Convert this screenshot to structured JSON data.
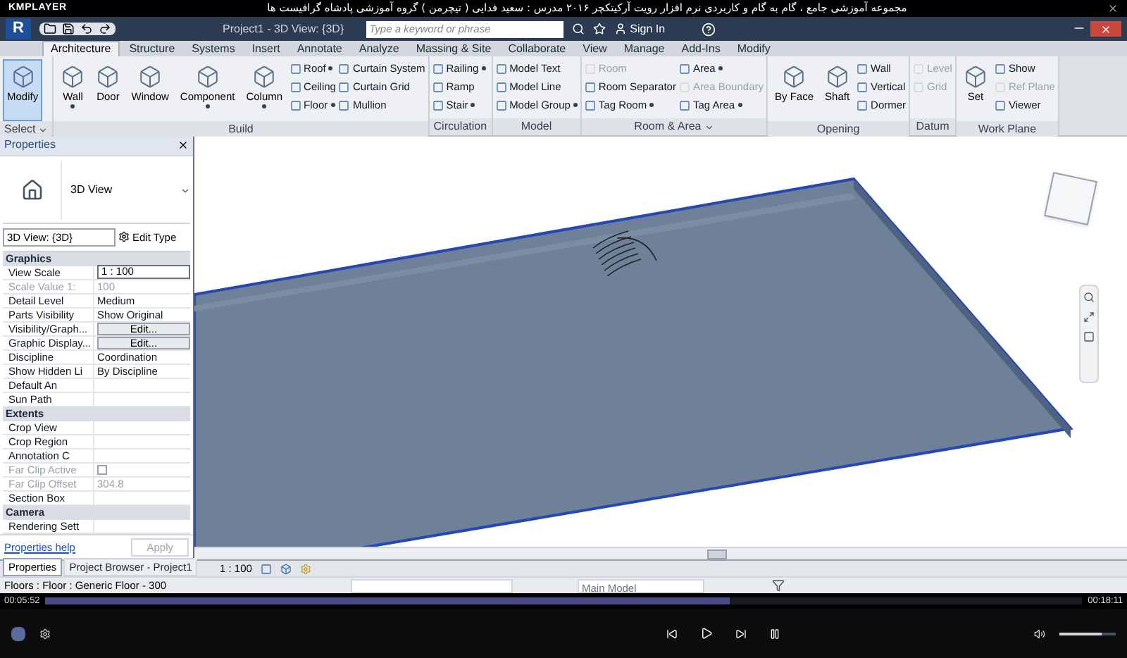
{
  "player": {
    "name": "KMPLAYER",
    "title": "مجموعه آموزشی جامع ، گام به گام و کاربردی نرم افزار رویت آرکیتکچر ۲۰۱۶   مدرس : سعید فدایی ( تیچرمن ) گروه آموزشی پادشاه گرافیست ها",
    "elapsed": "00:05:52",
    "total": "00:18:11",
    "seek": {
      "level": 0.66
    },
    "volume": {
      "level": 0.75
    }
  },
  "app": {
    "logo": "R",
    "title": "Project1 - 3D View: {3D}",
    "search": {
      "placeholder": "Type a keyword or phrase"
    },
    "sign_in": "Sign In"
  },
  "tabs": [
    {
      "label": "Architecture",
      "selected": true
    },
    {
      "label": "Structure",
      "selected": false
    },
    {
      "label": "Systems",
      "selected": false
    },
    {
      "label": "Insert",
      "selected": false
    },
    {
      "label": "Annotate",
      "selected": false
    },
    {
      "label": "Analyze",
      "selected": false
    },
    {
      "label": "Massing & Site",
      "selected": false
    },
    {
      "label": "Collaborate",
      "selected": false
    },
    {
      "label": "View",
      "selected": false
    },
    {
      "label": "Manage",
      "selected": false
    },
    {
      "label": "Add-Ins",
      "selected": false
    },
    {
      "label": "Modify",
      "selected": false
    }
  ],
  "ribbon": [
    {
      "title": "Select",
      "menu": true,
      "columns": [
        {
          "kind": "large",
          "label": "Modify",
          "selected": true,
          "dropdown": false
        }
      ]
    },
    {
      "title": "Build",
      "menu": false,
      "columns": [
        {
          "kind": "large",
          "label": "Wall",
          "selected": false,
          "dropdown": true
        },
        {
          "kind": "large",
          "label": "Door",
          "selected": false,
          "dropdown": false
        },
        {
          "kind": "large",
          "label": "Window",
          "selected": false,
          "dropdown": false
        },
        {
          "kind": "large",
          "label": "Component",
          "selected": false,
          "dropdown": true
        },
        {
          "kind": "large",
          "label": "Column",
          "selected": false,
          "dropdown": true
        },
        {
          "kind": "stack",
          "items": [
            {
              "label": "Roof",
              "disabled": false,
              "dropdown": true
            },
            {
              "label": "Ceiling",
              "disabled": false,
              "dropdown": false
            },
            {
              "label": "Floor",
              "disabled": false,
              "dropdown": true
            }
          ]
        },
        {
          "kind": "stack",
          "items": [
            {
              "label": "Curtain System",
              "disabled": false,
              "dropdown": false
            },
            {
              "label": "Curtain Grid",
              "disabled": false,
              "dropdown": false
            },
            {
              "label": "Mullion",
              "disabled": false,
              "dropdown": false
            }
          ]
        }
      ]
    },
    {
      "title": "Circulation",
      "menu": false,
      "columns": [
        {
          "kind": "stack",
          "items": [
            {
              "label": "Railing",
              "disabled": false,
              "dropdown": true
            },
            {
              "label": "Ramp",
              "disabled": false,
              "dropdown": false
            },
            {
              "label": "Stair",
              "disabled": false,
              "dropdown": true
            }
          ]
        }
      ]
    },
    {
      "title": "Model",
      "menu": false,
      "columns": [
        {
          "kind": "stack",
          "items": [
            {
              "label": "Model Text",
              "disabled": false,
              "dropdown": false
            },
            {
              "label": "Model Line",
              "disabled": false,
              "dropdown": false
            },
            {
              "label": "Model Group",
              "disabled": false,
              "dropdown": true
            }
          ]
        }
      ]
    },
    {
      "title": "Room & Area",
      "menu": true,
      "columns": [
        {
          "kind": "stack",
          "items": [
            {
              "label": "Room",
              "disabled": true,
              "dropdown": false
            },
            {
              "label": "Room Separator",
              "disabled": false,
              "dropdown": false
            },
            {
              "label": "Tag Room",
              "disabled": false,
              "dropdown": true
            }
          ]
        },
        {
          "kind": "stack",
          "items": [
            {
              "label": "Area",
              "disabled": false,
              "dropdown": true
            },
            {
              "label": "Area Boundary",
              "disabled": true,
              "dropdown": false
            },
            {
              "label": "Tag Area",
              "disabled": false,
              "dropdown": true
            }
          ]
        }
      ]
    },
    {
      "title": "Opening",
      "menu": false,
      "columns": [
        {
          "kind": "large",
          "label": "By Face",
          "selected": false,
          "dropdown": false
        },
        {
          "kind": "large",
          "label": "Shaft",
          "selected": false,
          "dropdown": false
        },
        {
          "kind": "stack",
          "items": [
            {
              "label": "Wall",
              "disabled": false,
              "dropdown": false
            },
            {
              "label": "Vertical",
              "disabled": false,
              "dropdown": false
            },
            {
              "label": "Dormer",
              "disabled": false,
              "dropdown": false
            }
          ]
        }
      ]
    },
    {
      "title": "Datum",
      "menu": false,
      "columns": [
        {
          "kind": "stack",
          "items": [
            {
              "label": "Level",
              "disabled": true,
              "dropdown": false
            },
            {
              "label": "Grid",
              "disabled": true,
              "dropdown": false
            }
          ]
        }
      ]
    },
    {
      "title": "Work Plane",
      "menu": false,
      "columns": [
        {
          "kind": "large",
          "label": "Set",
          "selected": false,
          "dropdown": false
        },
        {
          "kind": "stack",
          "items": [
            {
              "label": "Show",
              "disabled": false,
              "dropdown": false
            },
            {
              "label": "Ref Plane",
              "disabled": true,
              "dropdown": false
            },
            {
              "label": "Viewer",
              "disabled": false,
              "dropdown": false
            }
          ]
        }
      ]
    }
  ],
  "properties": {
    "title": "Properties",
    "type_name": "3D View",
    "view_selector": "3D View: {3D}",
    "edit_type": "Edit Type",
    "rows": [
      {
        "kind": "section",
        "label": "Graphics"
      },
      {
        "kind": "input",
        "name": "View Scale",
        "value": "1 : 100",
        "disabled": false
      },
      {
        "kind": "text",
        "name": "Scale Value    1:",
        "value": "100",
        "disabled": true
      },
      {
        "kind": "text",
        "name": "Detail Level",
        "value": "Medium",
        "disabled": false
      },
      {
        "kind": "text",
        "name": "Parts Visibility",
        "value": "Show Original",
        "disabled": false
      },
      {
        "kind": "button",
        "name": "Visibility/Graph...",
        "value": "Edit...",
        "disabled": false
      },
      {
        "kind": "button",
        "name": "Graphic Display...",
        "value": "Edit...",
        "disabled": false
      },
      {
        "kind": "text",
        "name": "Discipline",
        "value": "Coordination",
        "disabled": false
      },
      {
        "kind": "text",
        "name": "Show Hidden Li",
        "value": "By Discipline",
        "disabled": false
      },
      {
        "kind": "text",
        "name": "Default An",
        "disabled": false
      },
      {
        "kind": "text",
        "name": "Sun Path",
        "disabled": false
      },
      {
        "kind": "section",
        "label": "Extents"
      },
      {
        "kind": "text",
        "name": "Crop View",
        "disabled": false
      },
      {
        "kind": "text",
        "name": "Crop Region",
        "disabled": false
      },
      {
        "kind": "text",
        "name": "Annotation C",
        "disabled": false
      },
      {
        "kind": "checkbox",
        "name": "Far Clip Active",
        "checked": false,
        "disabled": true
      },
      {
        "kind": "text",
        "name": "Far Clip Offset",
        "value": "304.8",
        "disabled": true
      },
      {
        "kind": "text",
        "name": "Section Box",
        "disabled": false
      },
      {
        "kind": "section",
        "label": "Camera"
      },
      {
        "kind": "text",
        "name": "Rendering Sett",
        "disabled": false
      }
    ],
    "help": "Properties help",
    "apply": "Apply"
  },
  "panel_tabs": [
    {
      "label": "Properties",
      "selected": true
    },
    {
      "label": "Project Browser - Project1",
      "selected": false
    }
  ],
  "view_scale": "1 : 100",
  "status": {
    "text": "Floors : Floor : Generic Floor - 300",
    "model": "Main Model"
  }
}
